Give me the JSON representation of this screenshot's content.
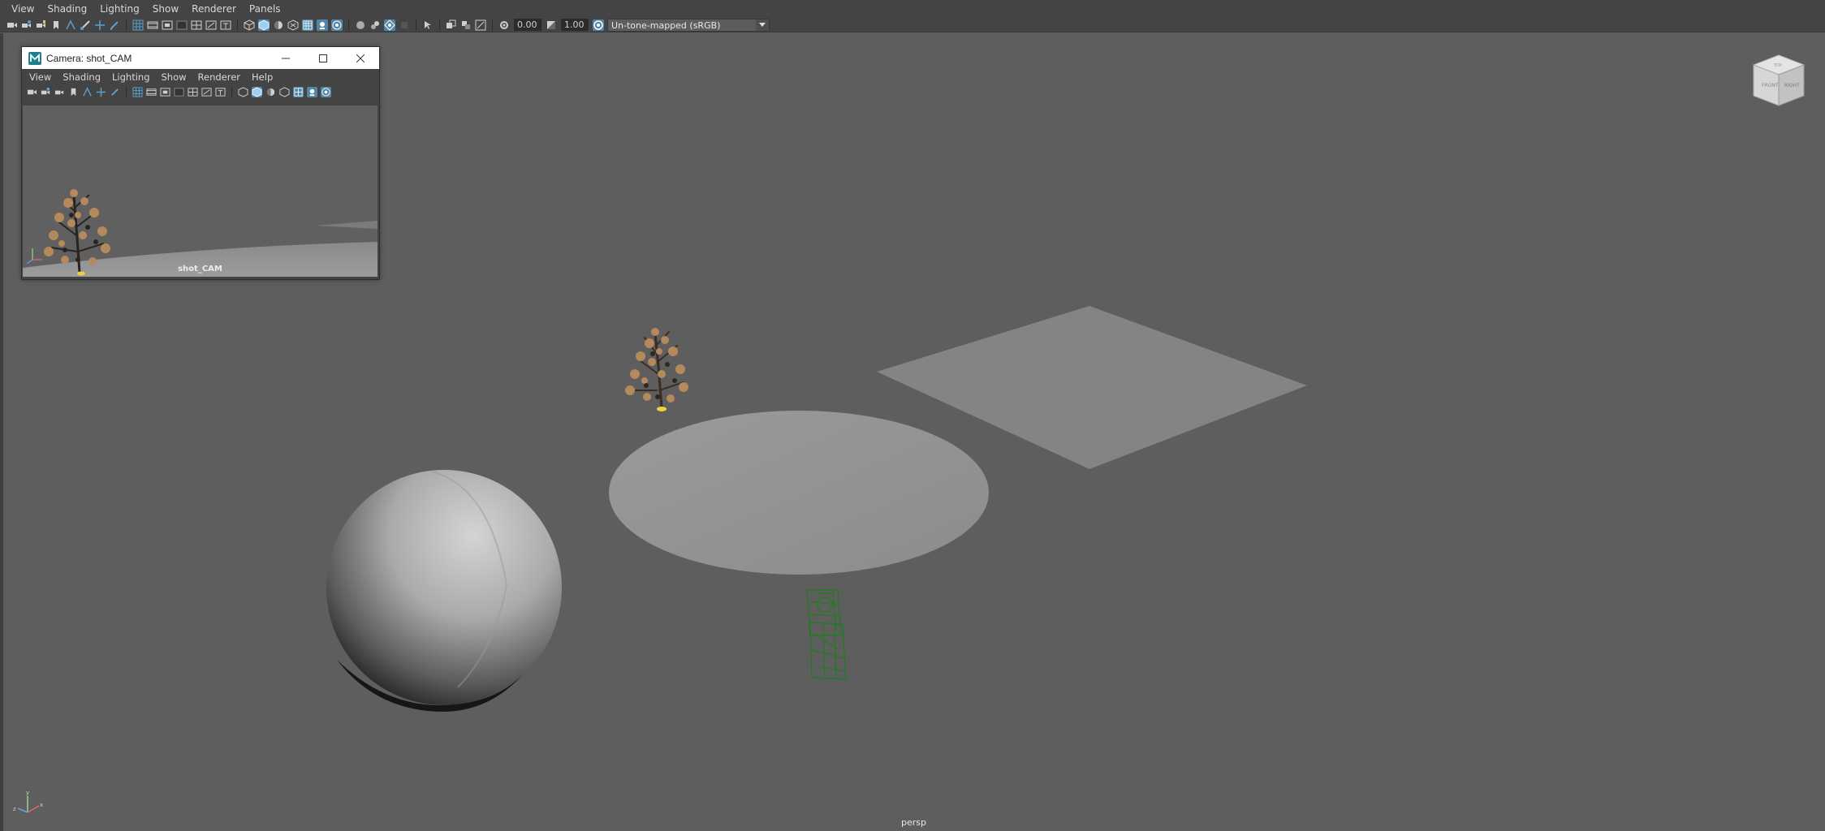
{
  "menubar": {
    "items": [
      "View",
      "Shading",
      "Lighting",
      "Show",
      "Renderer",
      "Panels"
    ]
  },
  "toolbar": {
    "exposure_value": "0.00",
    "gamma_value": "1.00",
    "color_management": "Un-tone-mapped (sRGB)"
  },
  "viewport": {
    "camera_label": "persp"
  },
  "camera_window": {
    "title": "Camera: shot_CAM",
    "menu": [
      "View",
      "Shading",
      "Lighting",
      "Show",
      "Renderer",
      "Help"
    ],
    "camera_label": "shot_CAM"
  },
  "view_cube": {
    "faces": [
      "FRONT",
      "RIGHT",
      "TOP"
    ]
  },
  "colors": {
    "viewport_bg": "#5e5e5e",
    "ui_bg": "#444444",
    "active_icon": "#5285a6",
    "wire_green": "#1f7a1f"
  }
}
